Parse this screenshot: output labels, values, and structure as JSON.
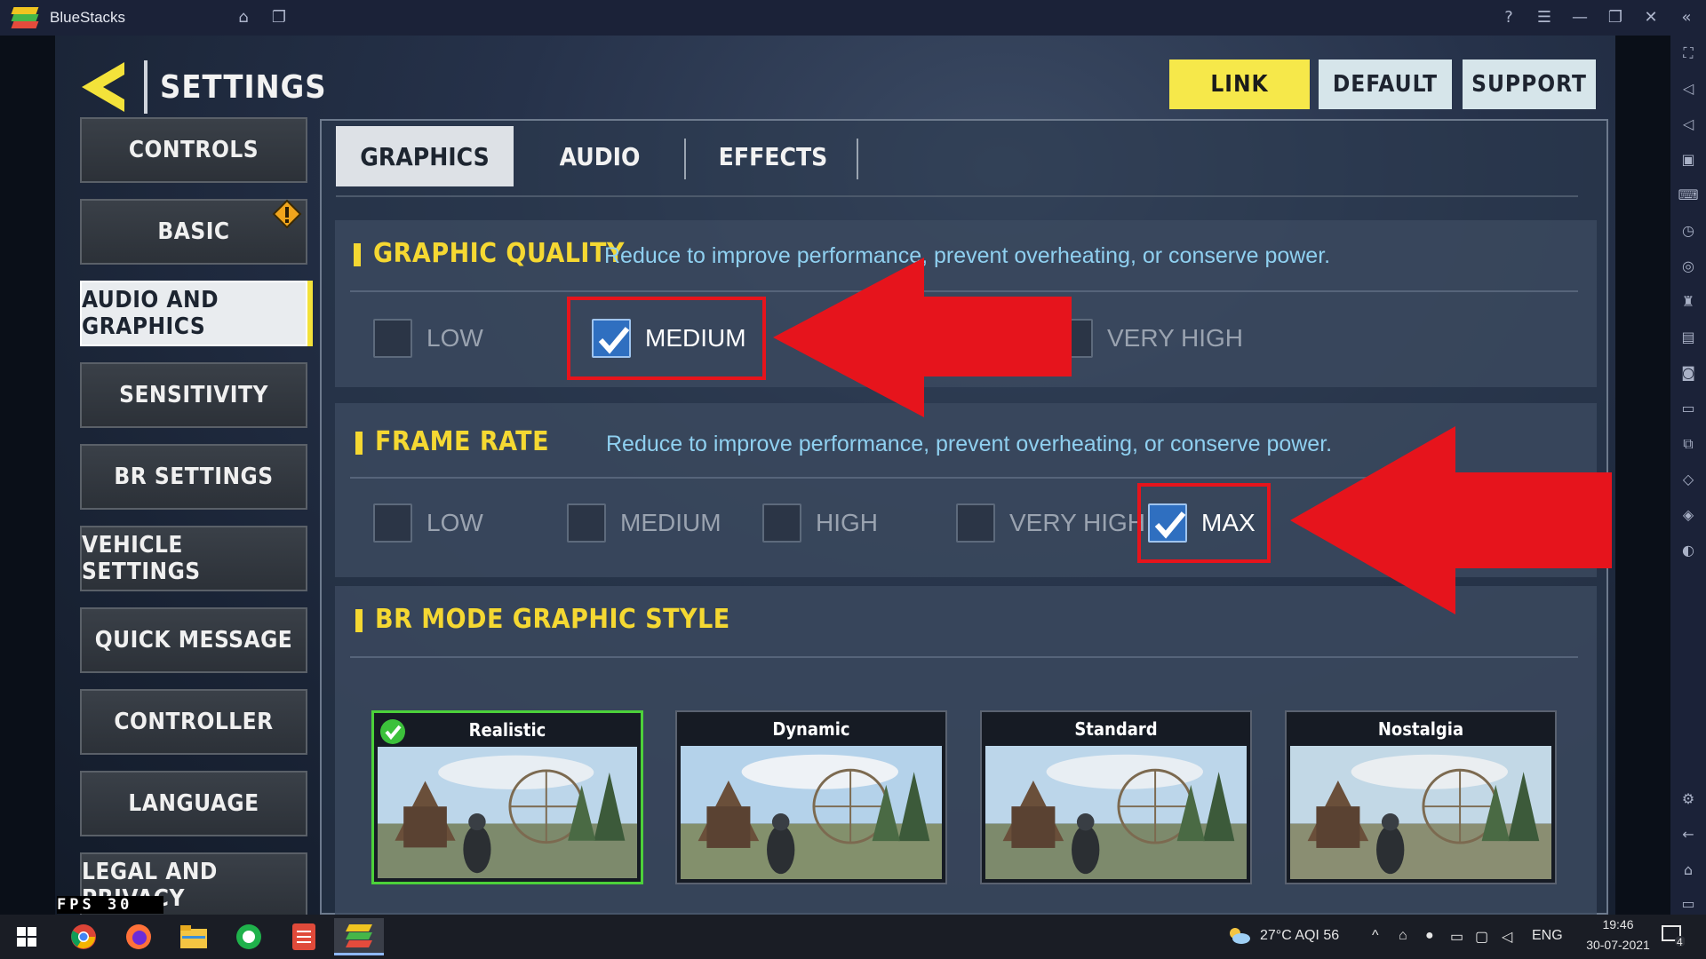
{
  "window": {
    "app_title": "BlueStacks",
    "titlebar_icons": [
      "home-icon",
      "multi-instance-icon",
      "help-icon",
      "menu-icon",
      "minimize-icon",
      "restore-icon",
      "close-icon",
      "collapse-sidebar-icon"
    ]
  },
  "settings": {
    "title": "SETTINGS",
    "header_buttons": {
      "link": "LINK",
      "default": "DEFAULT",
      "support": "SUPPORT"
    },
    "menu": [
      {
        "label": "CONTROLS",
        "active": false
      },
      {
        "label": "BASIC",
        "active": false,
        "warning": true
      },
      {
        "label": "AUDIO AND GRAPHICS",
        "active": true
      },
      {
        "label": "SENSITIVITY",
        "active": false
      },
      {
        "label": "BR SETTINGS",
        "active": false
      },
      {
        "label": "VEHICLE SETTINGS",
        "active": false
      },
      {
        "label": "QUICK MESSAGE",
        "active": false
      },
      {
        "label": "CONTROLLER",
        "active": false
      },
      {
        "label": "LANGUAGE",
        "active": false
      },
      {
        "label": "LEGAL AND PRIVACY",
        "active": false
      }
    ],
    "tabs": [
      {
        "label": "GRAPHICS",
        "active": true
      },
      {
        "label": "AUDIO",
        "active": false
      },
      {
        "label": "EFFECTS",
        "active": false
      }
    ],
    "graphic_quality": {
      "title": "GRAPHIC QUALITY",
      "description": "Reduce to improve performance, prevent overheating, or conserve power.",
      "options": [
        {
          "label": "LOW",
          "checked": false
        },
        {
          "label": "MEDIUM",
          "checked": true
        },
        {
          "label": "VERY HIGH",
          "checked": false
        }
      ]
    },
    "frame_rate": {
      "title": "FRAME RATE",
      "description": "Reduce to improve performance, prevent overheating, or conserve power.",
      "options": [
        {
          "label": "LOW",
          "checked": false
        },
        {
          "label": "MEDIUM",
          "checked": false
        },
        {
          "label": "HIGH",
          "checked": false
        },
        {
          "label": "VERY HIGH",
          "checked": false
        },
        {
          "label": "MAX",
          "checked": true
        }
      ]
    },
    "br_mode_style": {
      "title": "BR MODE GRAPHIC STYLE",
      "styles": [
        {
          "label": "Realistic",
          "selected": true
        },
        {
          "label": "Dynamic",
          "selected": false
        },
        {
          "label": "Standard",
          "selected": false
        },
        {
          "label": "Nostalgia",
          "selected": false
        }
      ]
    },
    "fps_overlay": "FPS  30"
  },
  "annotations": {
    "highlight_color": "#e6141c"
  },
  "colors": {
    "accent_yellow": "#f5d832",
    "link_button": "#f6e84a",
    "checkbox_blue": "#2f6fc0",
    "selected_green": "#4cd13a"
  },
  "taskbar": {
    "apps": [
      "windows-start-icon",
      "chrome-icon",
      "firefox-icon",
      "file-explorer-icon",
      "green-app-icon",
      "red-app-icon",
      "bluestacks-icon"
    ],
    "weather": "27°C  AQI 56",
    "language": "ENG",
    "time": "19:46",
    "date": "30-07-2021",
    "notification_count": "4"
  }
}
